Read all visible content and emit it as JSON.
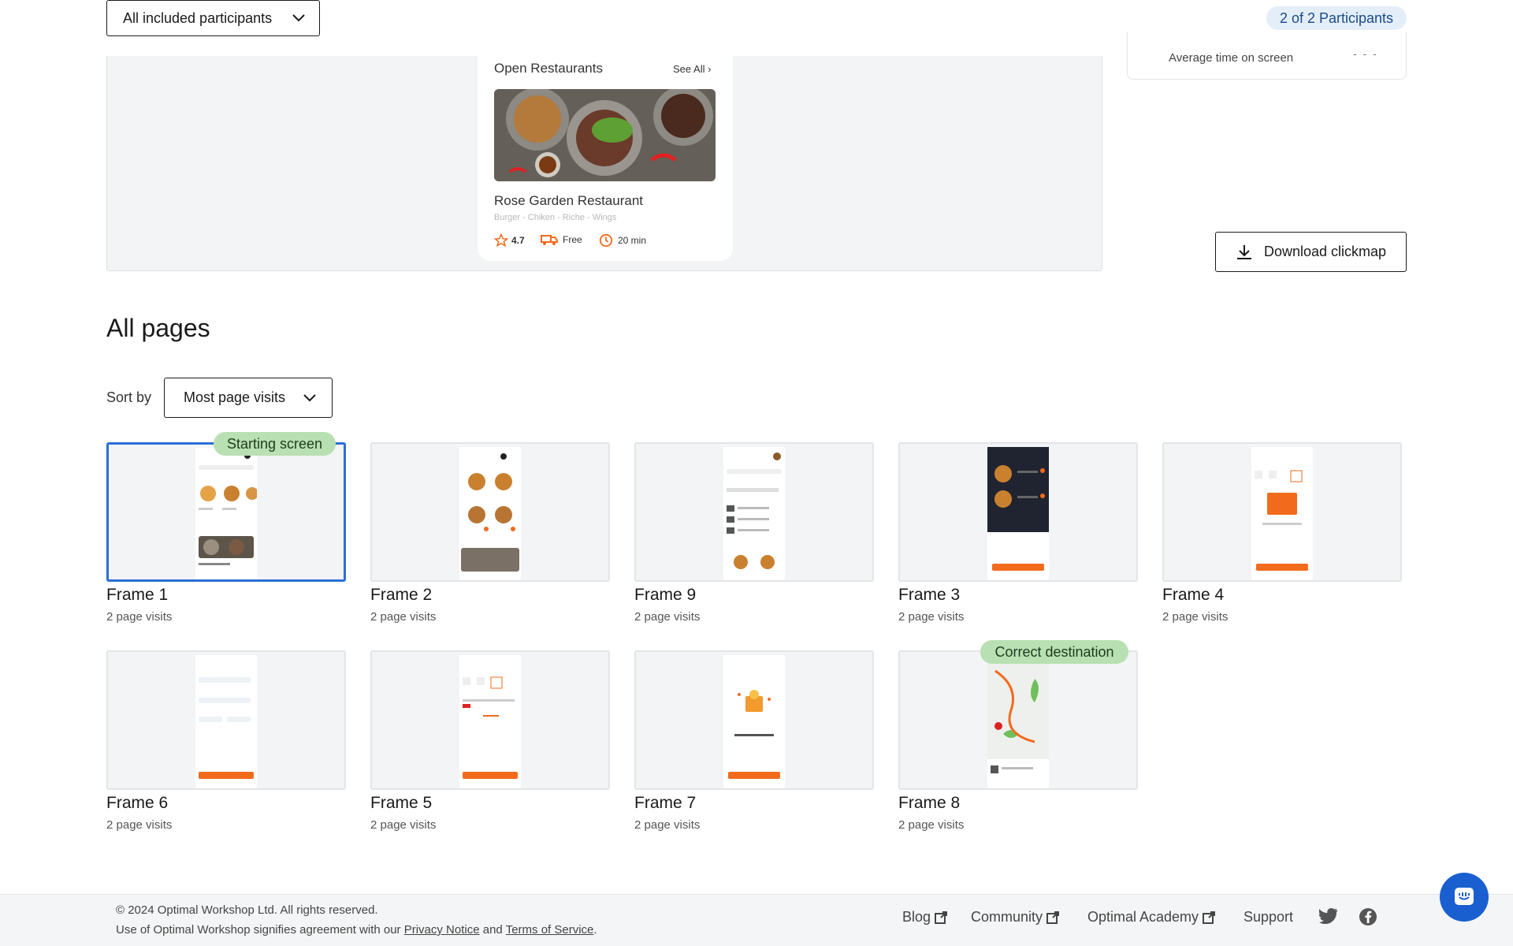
{
  "filters": {
    "participants_dropdown": "All included participants",
    "participants_count": "2 of 2 Participants"
  },
  "preview": {
    "section_title": "Open Restaurants",
    "see_all": "See All",
    "restaurant_name": "Rose Garden Restaurant",
    "restaurant_tags": "Burger - Chiken - Riche - Wings",
    "rating": "4.7",
    "delivery": "Free",
    "time": "20 min"
  },
  "stats": {
    "avg_time_label": "Average time on screen",
    "avg_time_value": "- - -"
  },
  "download_button": "Download clickmap",
  "all_pages": {
    "heading": "All pages",
    "sort_label": "Sort by",
    "sort_value": "Most page visits"
  },
  "frames": [
    {
      "name": "Frame 1",
      "visits": "2 page visits",
      "tag": "Starting screen"
    },
    {
      "name": "Frame 2",
      "visits": "2 page visits"
    },
    {
      "name": "Frame 9",
      "visits": "2 page visits"
    },
    {
      "name": "Frame 3",
      "visits": "2 page visits"
    },
    {
      "name": "Frame 4",
      "visits": "2 page visits"
    },
    {
      "name": "Frame 6",
      "visits": "2 page visits"
    },
    {
      "name": "Frame 5",
      "visits": "2 page visits"
    },
    {
      "name": "Frame 7",
      "visits": "2 page visits"
    },
    {
      "name": "Frame 8",
      "visits": "2 page visits",
      "tag": "Correct destination"
    }
  ],
  "footer": {
    "copyright": "© 2024 Optimal Workshop Ltd. All rights reserved.",
    "terms_prefix": "Use of Optimal Workshop signifies agreement with our",
    "privacy": "Privacy Notice",
    "and": "and",
    "tos": "Terms of Service",
    "period": ".",
    "links": [
      "Blog",
      "Community",
      "Optimal Academy",
      "Support"
    ]
  },
  "colors": {
    "accent_blue": "#2b6fd6",
    "tag_green": "#b8e0b2",
    "badge_blue": "#e4eef9",
    "orange": "#f26b1d"
  }
}
